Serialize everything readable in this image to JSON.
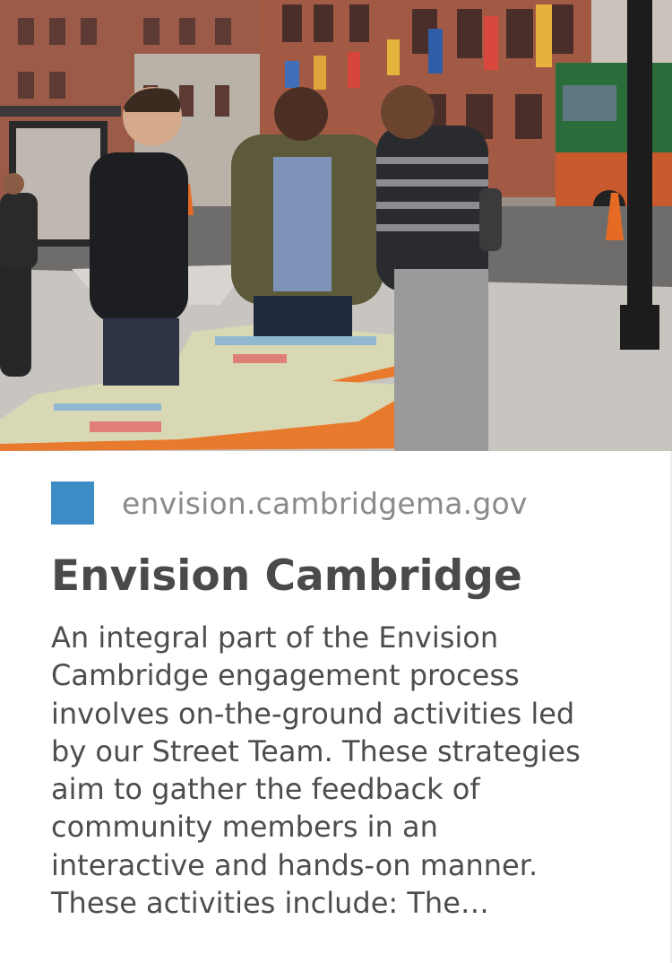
{
  "card": {
    "domain": "envision.cambridgema.gov",
    "title": "Envision Cambridge",
    "description_lines": [
      "An integral part of the Envision",
      "Cambridge engagement process",
      "involves on-the-ground activities led",
      "by our Street Team. These strategies",
      "aim to gather the feedback of",
      "community members in an",
      "interactive and hands-on manner.",
      "These activities include: The…"
    ],
    "favicon_color": "#3c8dc5",
    "image_icon": "street-team-photo"
  }
}
